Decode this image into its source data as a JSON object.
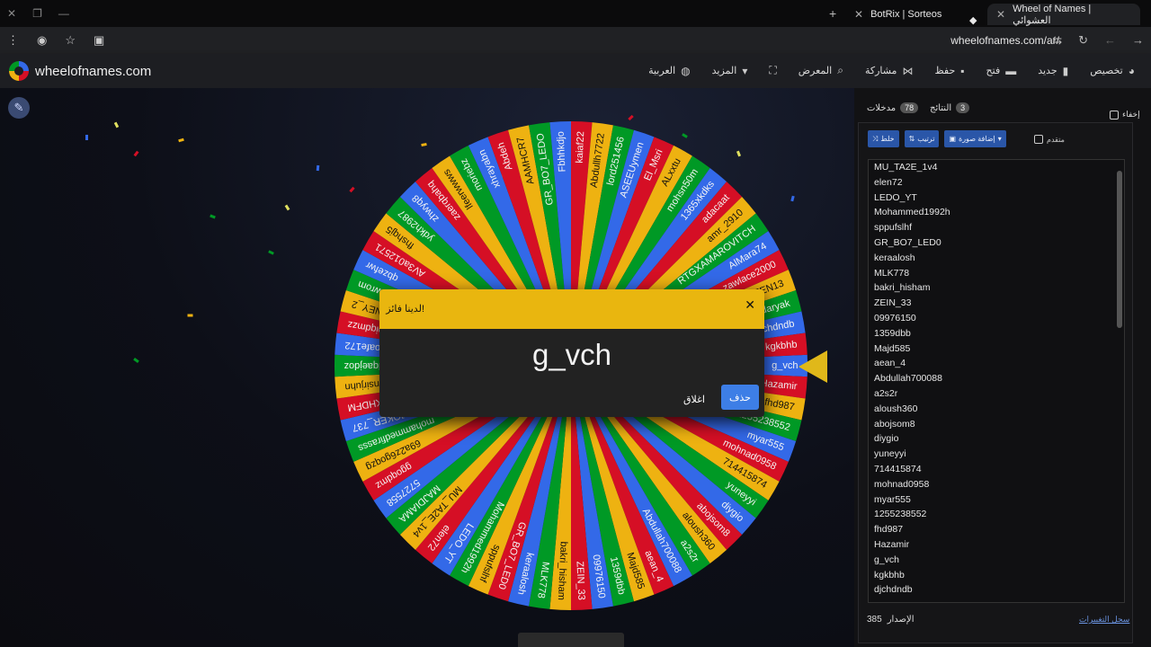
{
  "browser": {
    "tabs": [
      {
        "title": "Wheel of Names | العشوائي",
        "active": true
      },
      {
        "title": "BotRix | Sorteos",
        "active": false
      }
    ],
    "url": "wheelofnames.com/ar/"
  },
  "app": {
    "brand": "wheelofnames.com",
    "menu": [
      {
        "label": "تخصيص",
        "icon": "palette-icon"
      },
      {
        "label": "جديد",
        "icon": "file-icon"
      },
      {
        "label": "فتح",
        "icon": "folder-icon"
      },
      {
        "label": "حفظ",
        "icon": "save-icon"
      },
      {
        "label": "مشاركة",
        "icon": "share-icon"
      },
      {
        "label": "المعرض",
        "icon": "search-icon"
      },
      {
        "label": "",
        "icon": "fullscreen-icon"
      },
      {
        "label": "المزيد",
        "icon": "caret-down-icon"
      },
      {
        "label": "العربية",
        "icon": "globe-icon"
      }
    ]
  },
  "wheel": {
    "colors": [
      "#3369e8",
      "#d50f25",
      "#eeb211",
      "#009925"
    ],
    "labels": [
      "g_vch",
      "Hazamir",
      "fhd987",
      "1255238552",
      "myar555",
      "mohnad0958",
      "714415874",
      "yuneyyi",
      "diygio",
      "abojsom8",
      "aloush360",
      "a2s2r",
      "Abdullah700088",
      "aean_4",
      "Majd585",
      "1359dbb",
      "09976150",
      "ZEIN_33",
      "bakri_hisham",
      "MLK778",
      "keraalosh",
      "GR_BO7_LED0",
      "sppufslhf",
      "Mohammed1992h",
      "LEDO_YT",
      "elen72",
      "MU_TA2E_1v4",
      "MAJDIAMA",
      "5727558",
      "ggoqdmz",
      "69a2z6goqzg",
      "mohammedfirasss",
      "JOKER_737",
      "FETNKHDFM",
      "insirjuhn",
      "lqaejdoz",
      "zoafe172",
      "xxpiqdmzz",
      "ANEY_2",
      "nwrom",
      "qbzefwr",
      "AV3a012571",
      "fhshqj5",
      "ydkh2987",
      "zhwyq8",
      "zaerqbahq",
      "lfeerwwws",
      "moriebz",
      "xhrayabn",
      "Abdeh",
      "AAMHCR7",
      "GR_BO7_LEDO",
      "Fbhhkdjo",
      "kaiaf22",
      "Abdullh7722",
      "lord251456",
      "ASEEUymen",
      "El_Msri",
      "ALxxtu",
      "mohsn50m",
      "1365xkdks",
      "adacaat",
      "amr_2910",
      "RTGXAMAROVITCH",
      "AlMara74",
      "zawlace2000",
      "SEEN13",
      "daryak",
      "djchdndb",
      "kgkbhb"
    ],
    "winner_index": 0
  },
  "modal": {
    "title": "لدينا فائز!",
    "winner": "g_vch",
    "close_label": "اغلاق",
    "remove_label": "حذف"
  },
  "panel": {
    "tab_entries": {
      "label": "مدخلات",
      "count": "78"
    },
    "tab_results": {
      "label": "النتائج",
      "count": "3"
    },
    "hide_label": "إخفاء",
    "shuffle_label": "خلط",
    "sort_label": "ترتيب",
    "add_image_label": "إضافة صورة",
    "advanced_label": "متقدم",
    "entries": [
      "MU_TA2E_1v4",
      "elen72",
      "LEDO_YT",
      "Mohammed1992h",
      "sppufslhf",
      "GR_BO7_LED0",
      "keraalosh",
      "MLK778",
      "bakri_hisham",
      "ZEIN_33",
      "09976150",
      "1359dbb",
      "Majd585",
      "aean_4",
      "Abdullah700088",
      "a2s2r",
      "aloush360",
      "abojsom8",
      "diygio",
      "yuneyyi",
      "714415874",
      "mohnad0958",
      "myar555",
      "1255238552",
      "fhd987",
      "Hazamir",
      "g_vch",
      "kgkbhb",
      "djchdndb"
    ],
    "version_label": "الإصدار",
    "version": "385",
    "changelog_label": "سجل التغييرات"
  }
}
